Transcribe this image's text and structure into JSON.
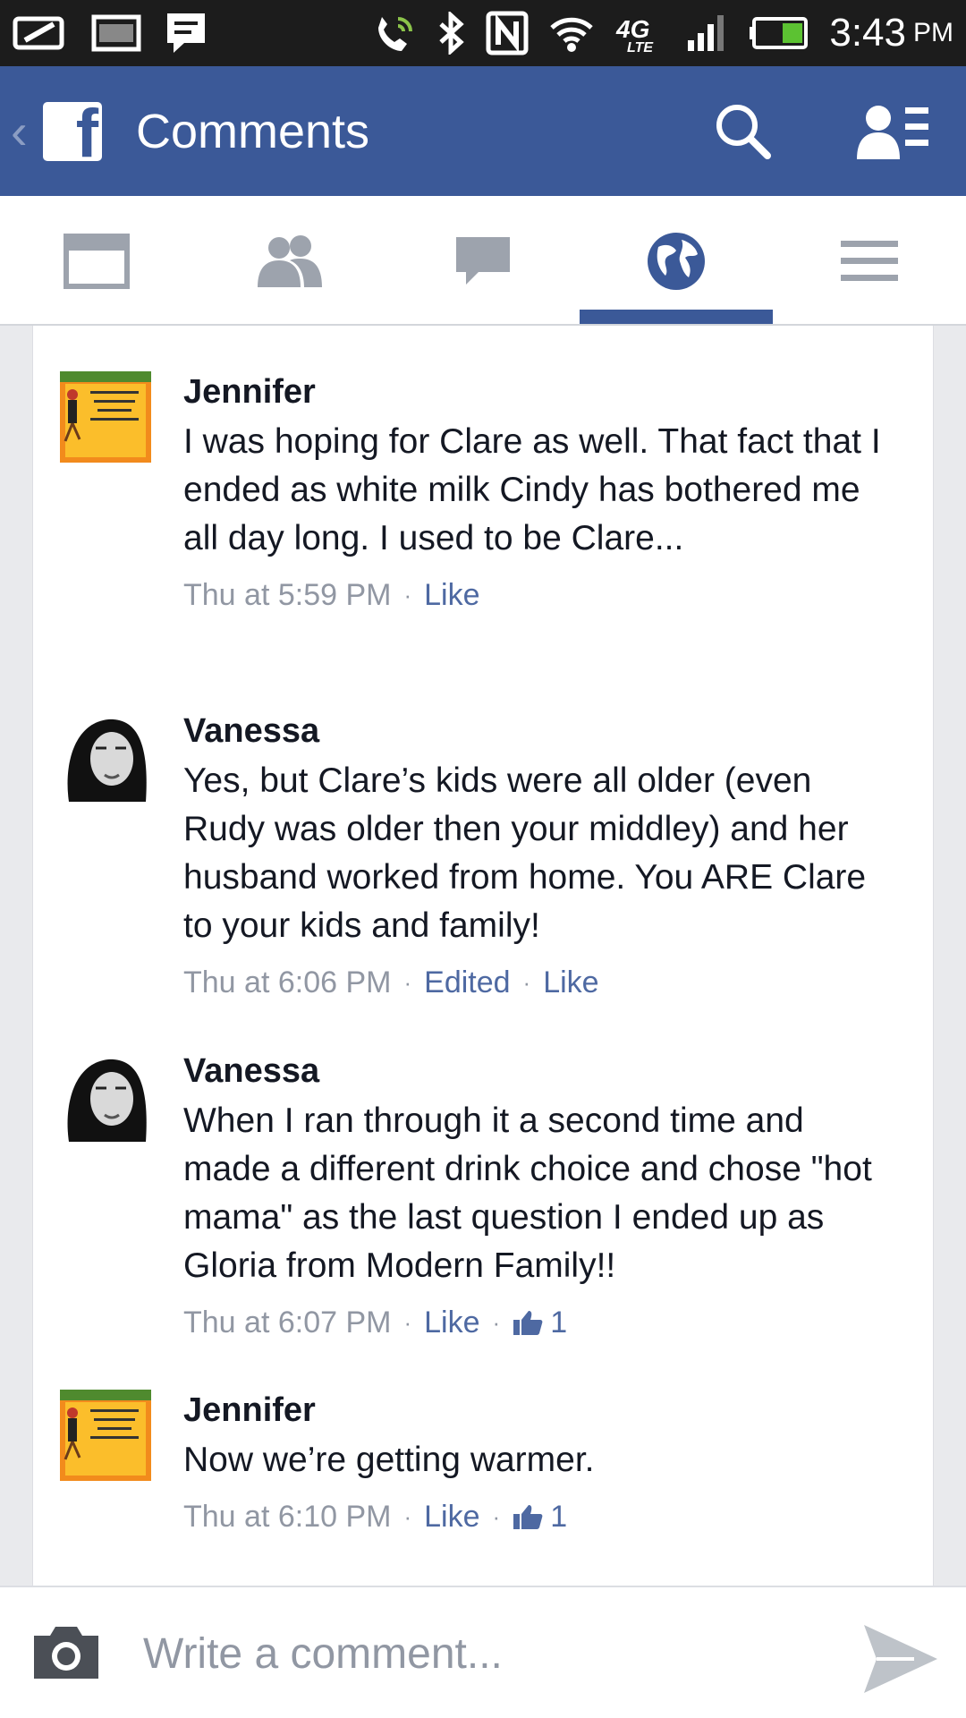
{
  "status_bar": {
    "time": "3:43",
    "am_pm": "PM",
    "network": "4G LTE",
    "icons": [
      "notification-icon",
      "gallery-icon",
      "message-icon",
      "call-icon",
      "bluetooth-icon",
      "nfc-icon",
      "wifi-icon",
      "lte-icon",
      "signal-icon",
      "battery-icon"
    ]
  },
  "app_bar": {
    "logo": "f",
    "title": "Comments",
    "back_icon": "‹",
    "background": "#3b5998"
  },
  "tabs": [
    {
      "name": "news-feed",
      "icon": "news-feed-icon",
      "active": false
    },
    {
      "name": "friends",
      "icon": "friends-icon",
      "active": false
    },
    {
      "name": "messages",
      "icon": "messages-icon",
      "active": false
    },
    {
      "name": "notifications",
      "icon": "globe-icon",
      "active": true
    },
    {
      "name": "more",
      "icon": "menu-icon",
      "active": false
    }
  ],
  "comments": [
    {
      "author": "Jennifer",
      "avatar": "yellow-meme-avatar",
      "text": "I was hoping for Clare as well. That fact that I ended as white milk Cindy has bothered me all day long. I used to be Clare...",
      "time": "Thu at 5:59 PM",
      "edited": null,
      "like_label": "Like",
      "like_count": null
    },
    {
      "author": "Vanessa",
      "avatar": "bw-portrait-avatar",
      "text": "Yes, but Clare’s kids were all older (even Rudy was older then your middley) and her husband worked from home. You ARE Clare to your kids and family!",
      "time": "Thu at 6:06 PM",
      "edited": "Edited",
      "like_label": "Like",
      "like_count": null
    },
    {
      "author": "Vanessa",
      "avatar": "bw-portrait-avatar",
      "text": "When I ran through it a second time and made a different drink choice and chose \"hot mama\" as the last question I ended up as Gloria from Modern Family!!",
      "time": "Thu at 6:07 PM",
      "edited": null,
      "like_label": "Like",
      "like_count": "1"
    },
    {
      "author": "Jennifer",
      "avatar": "yellow-meme-avatar",
      "text": "Now we’re getting warmer.",
      "time": "Thu at 6:10 PM",
      "edited": null,
      "like_label": "Like",
      "like_count": "1"
    }
  ],
  "meta_separator": "·",
  "composer": {
    "placeholder": "Write a comment..."
  },
  "colors": {
    "brand": "#3b5998",
    "link": "#4e69a2",
    "muted": "#9197a3",
    "text": "#141823"
  }
}
